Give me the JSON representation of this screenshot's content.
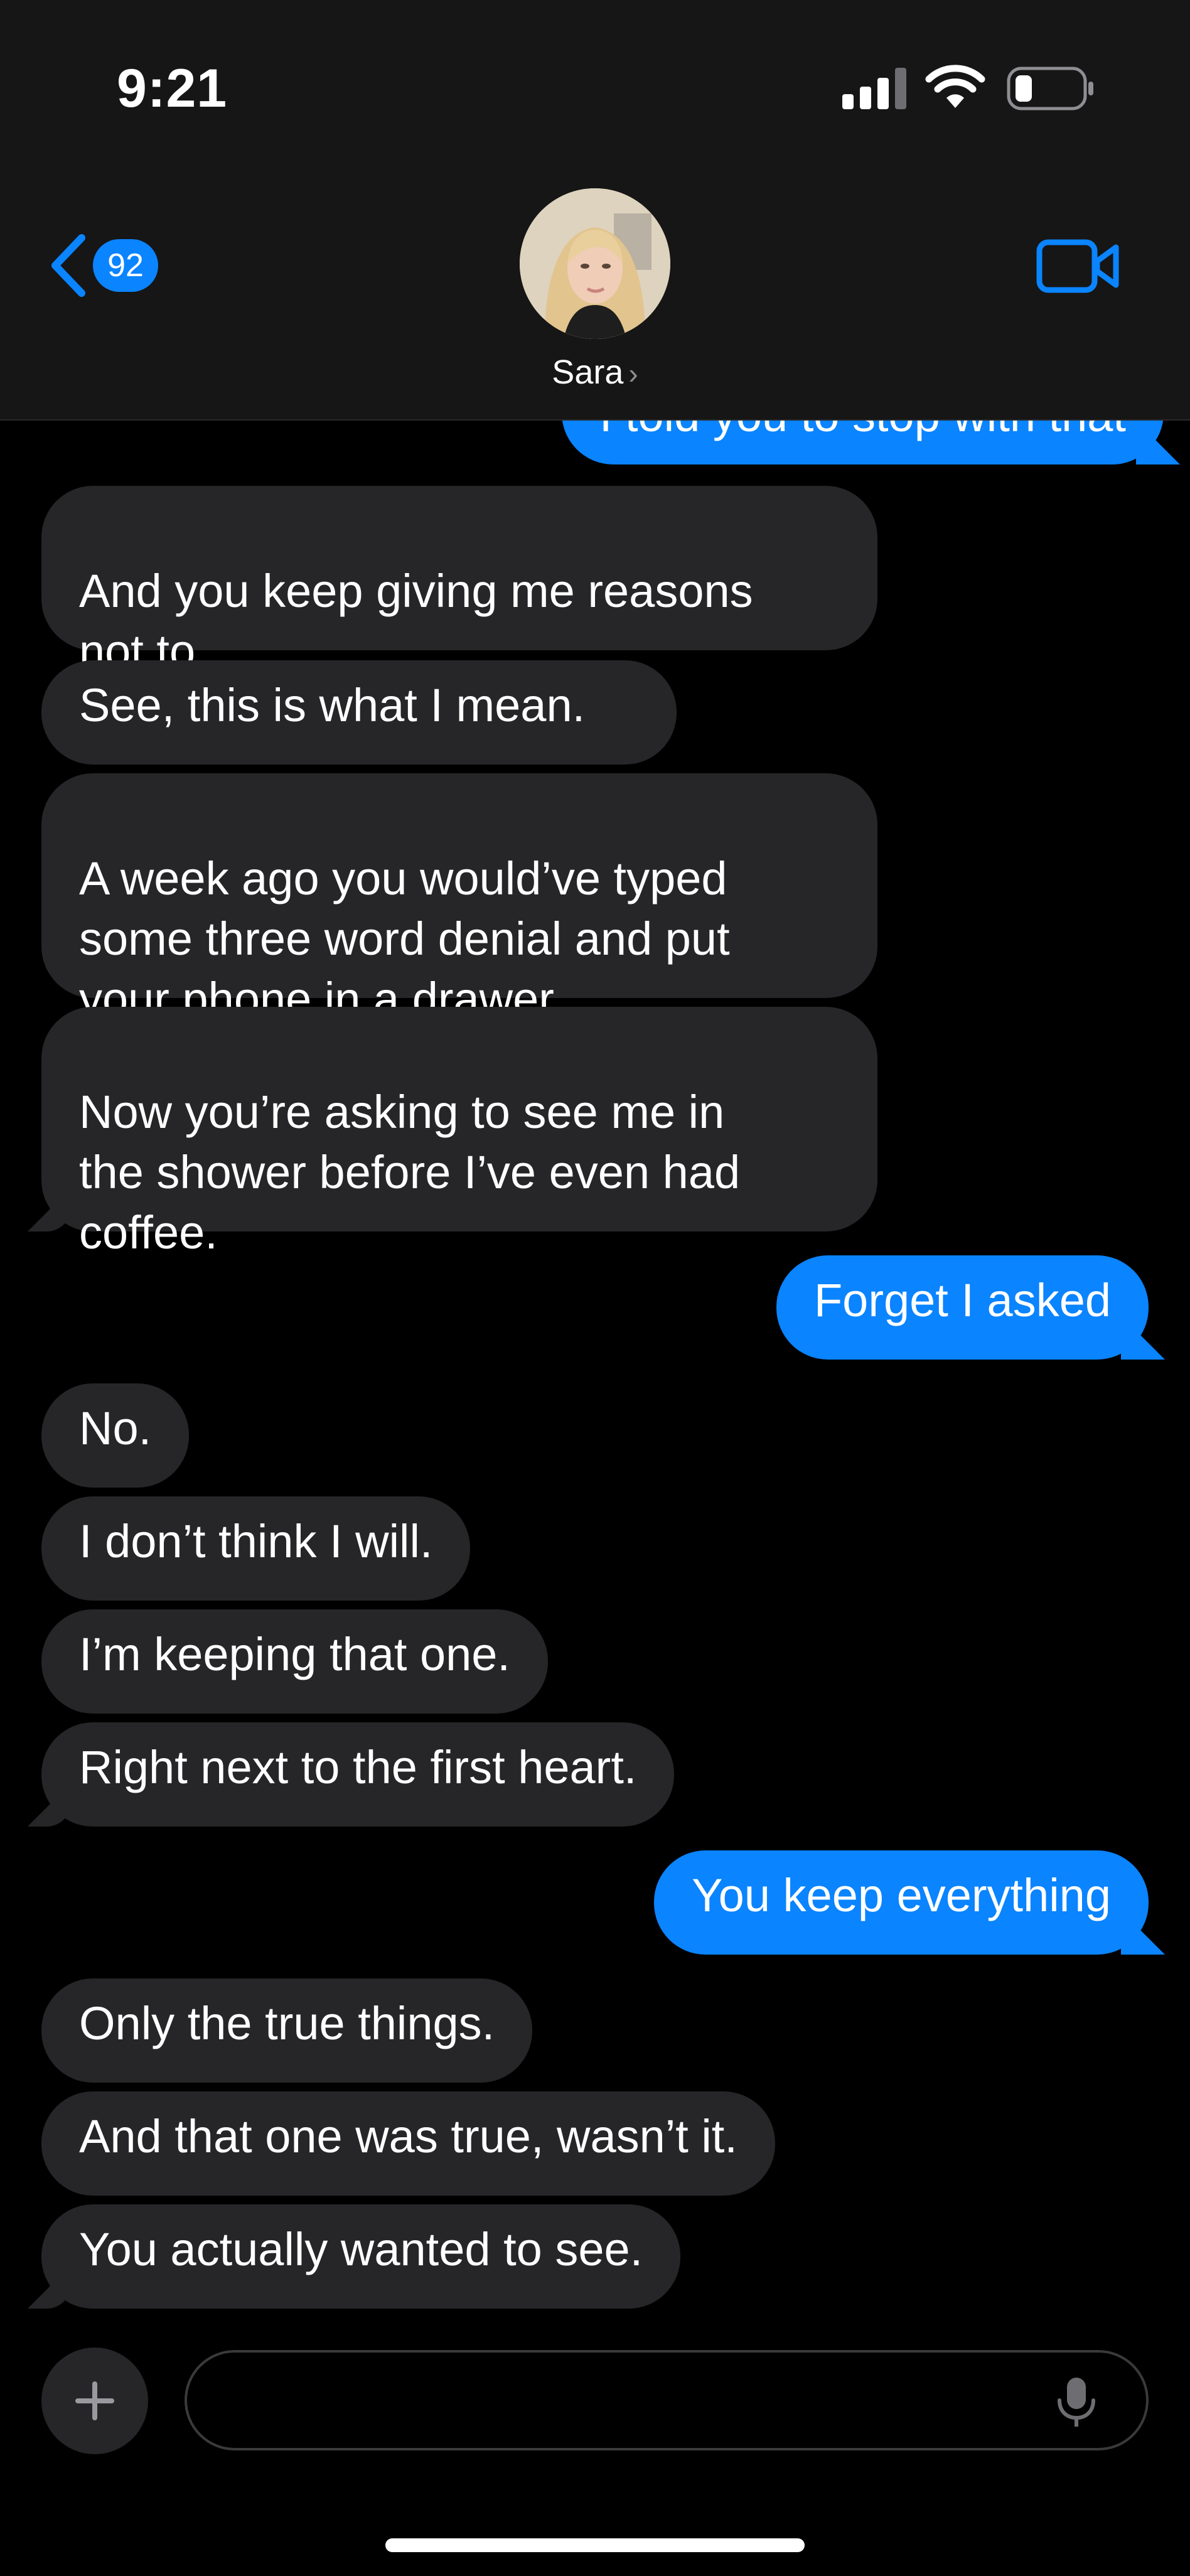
{
  "status_bar": {
    "time": "9:21"
  },
  "nav": {
    "back_badge": "92",
    "contact_name": "Sara",
    "name_chevron": "›"
  },
  "messages": [
    {
      "side": "out",
      "text": "I told you to stop with that"
    },
    {
      "side": "in",
      "text": "And you keep giving me reasons\nnot to."
    },
    {
      "side": "in",
      "text": "See, this is what I mean."
    },
    {
      "side": "in",
      "text": "A week ago you would’ve typed\nsome three word denial and put\nyour phone in a drawer."
    },
    {
      "side": "in",
      "text": "Now you’re asking to see me in\nthe shower before I’ve even had\ncoffee."
    },
    {
      "side": "out",
      "text": "Forget I asked"
    },
    {
      "side": "in",
      "text": "No."
    },
    {
      "side": "in",
      "text": "I don’t think I will."
    },
    {
      "side": "in",
      "text": "I’m keeping that one."
    },
    {
      "side": "in",
      "text": "Right next to the first heart."
    },
    {
      "side": "out",
      "text": "You keep everything"
    },
    {
      "side": "in",
      "text": "Only the true things."
    },
    {
      "side": "in",
      "text": "And that one was true, wasn’t it."
    },
    {
      "side": "in",
      "text": "You actually wanted to see."
    }
  ],
  "composer": {
    "placeholder": ""
  },
  "icons": {
    "back": "chevron-left-icon",
    "video": "video-camera-icon",
    "plus": "plus-icon",
    "mic": "microphone-icon"
  },
  "colors": {
    "accent": "#0a84ff",
    "incoming_bubble": "#262628",
    "background": "#000000"
  }
}
